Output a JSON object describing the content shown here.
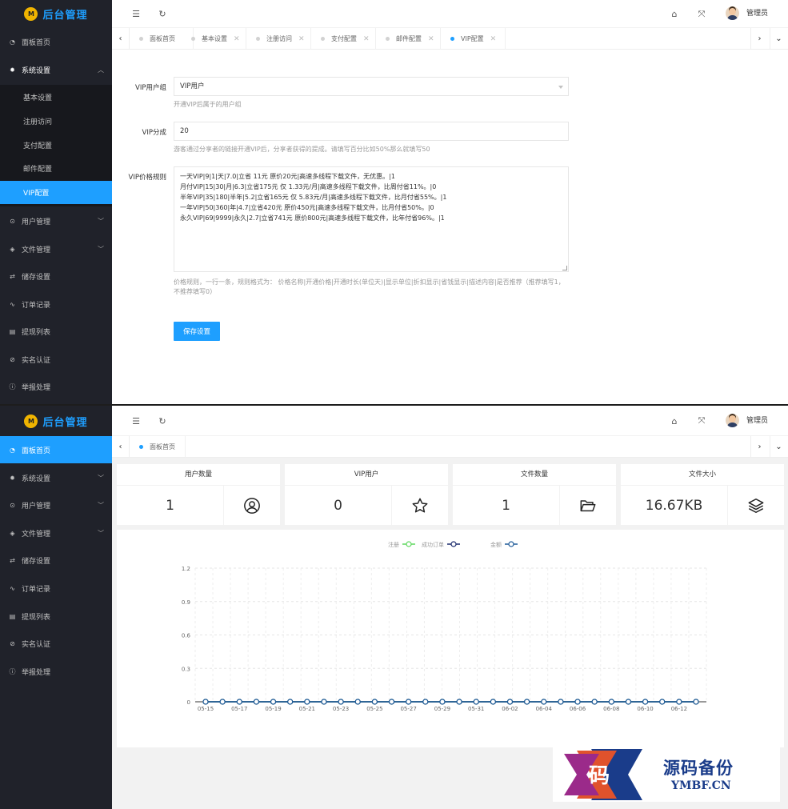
{
  "app": {
    "title": "后台管理",
    "user_name": "管理员"
  },
  "shot1": {
    "menu": [
      {
        "label": "面板首页"
      },
      {
        "label": "系统设置"
      },
      {
        "label": "用户管理"
      },
      {
        "label": "文件管理"
      },
      {
        "label": "储存设置"
      },
      {
        "label": "订单记录"
      },
      {
        "label": "提现列表"
      },
      {
        "label": "实名认证"
      },
      {
        "label": "举报处理"
      }
    ],
    "submenu": [
      "基本设置",
      "注册访问",
      "支付配置",
      "邮件配置",
      "VIP配置"
    ],
    "tabs": [
      "面板首页",
      "基本设置",
      "注册访问",
      "支付配置",
      "邮件配置",
      "VIP配置"
    ],
    "form": {
      "vip_group_label": "VIP用户组",
      "vip_group_value": "VIP用户",
      "vip_group_hint": "开通VIP后属于的用户组",
      "share_label": "VIP分成",
      "share_value": "20",
      "share_hint": "游客通过分享者的链接开通VIP后，分享者获得的提成。请填写百分比如50%那么就填写50",
      "rules_label": "VIP价格规则",
      "rules_lines": [
        "一天VIP|9|1|天|7.0|立省 11元 原价20元|高速多线程下载文件，无优惠。|1",
        "月付VIP|15|30|月|6.3|立省175元 仅 1.33元/月|高速多线程下载文件，比周付省11%。|0",
        "半年VIP|35|180|半年|5.2|立省165元 仅 5.83元/月|高速多线程下载文件，比月付省55%。|1",
        "一年VIP|50|360|年|4.7|立省420元 原价450元|高速多线程下载文件，比月付省50%。|0",
        "永久VIP|69|9999|永久|2.7|立省741元 原价800元|高速多线程下载文件，比年付省96%。|1"
      ],
      "rules_hint": "价格规则，一行一条，规则格式为： 价格名称|开通价格|开通时长(单位天)|显示单位|折扣显示|省钱显示|描述内容|是否推荐（推荐填写1，不推荐填写0）",
      "save_label": "保存设置"
    }
  },
  "shot2": {
    "menu": [
      {
        "label": "面板首页"
      },
      {
        "label": "系统设置"
      },
      {
        "label": "用户管理"
      },
      {
        "label": "文件管理"
      },
      {
        "label": "储存设置"
      },
      {
        "label": "订单记录"
      },
      {
        "label": "提现列表"
      },
      {
        "label": "实名认证"
      },
      {
        "label": "举报处理"
      }
    ],
    "tabs": [
      "面板首页"
    ],
    "stats": [
      {
        "title": "用户数量",
        "value": "1",
        "icon": "user-circle-icon"
      },
      {
        "title": "VIP用户",
        "value": "0",
        "icon": "star-icon"
      },
      {
        "title": "文件数量",
        "value": "1",
        "icon": "folder-open-icon"
      },
      {
        "title": "文件大小",
        "value": "16.67KB",
        "icon": "layers-icon"
      }
    ]
  },
  "chart_data": {
    "type": "line",
    "categories": [
      "05-15",
      "05-16",
      "05-17",
      "05-18",
      "05-19",
      "05-20",
      "05-21",
      "05-22",
      "05-23",
      "05-24",
      "05-25",
      "05-26",
      "05-27",
      "05-28",
      "05-29",
      "05-30",
      "05-31",
      "06-01",
      "06-02",
      "06-03",
      "06-04",
      "06-05",
      "06-06",
      "06-07",
      "06-08",
      "06-09",
      "06-10",
      "06-11",
      "06-12",
      "06-13"
    ],
    "series": [
      {
        "name": "注册",
        "color": "#5ed75e",
        "values": [
          0,
          0,
          0,
          0,
          0,
          0,
          0,
          0,
          0,
          0,
          0,
          0,
          0,
          0,
          0,
          0,
          0,
          0,
          0,
          0,
          0,
          0,
          0,
          0,
          0,
          0,
          0,
          0,
          0,
          0
        ]
      },
      {
        "name": "成功订单",
        "color": "#1a2a6c",
        "values": [
          0,
          0,
          0,
          0,
          0,
          0,
          0,
          0,
          0,
          0,
          0,
          0,
          0,
          0,
          0,
          0,
          0,
          0,
          0,
          0,
          0,
          0,
          0,
          0,
          0,
          0,
          0,
          0,
          0,
          0
        ]
      },
      {
        "name": "金额",
        "color": "#1f5b99",
        "values": [
          0,
          0,
          0,
          0,
          0,
          0,
          0,
          0,
          0,
          0,
          0,
          0,
          0,
          0,
          0,
          0,
          0,
          0,
          0,
          0,
          0,
          0,
          0,
          0,
          0,
          0,
          0,
          0,
          0,
          0
        ]
      }
    ],
    "yticks": [
      "0",
      "0.3",
      "0.6",
      "0.9",
      "1.2"
    ],
    "ylim": [
      0,
      1.2
    ],
    "grid": true,
    "legend": "top-center"
  },
  "watermark": {
    "main": "源码备份",
    "sub": "YMBF.CN",
    "glyph": "码"
  }
}
